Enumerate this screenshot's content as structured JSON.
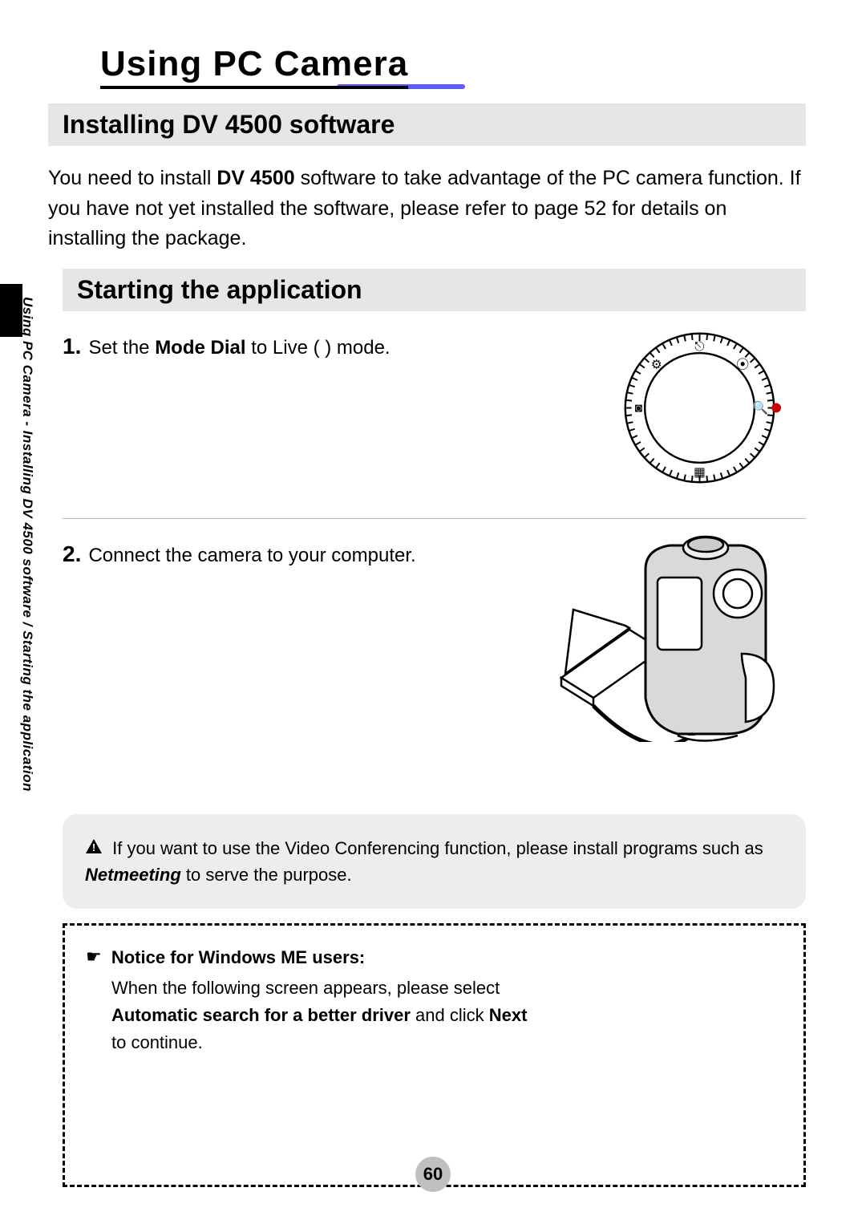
{
  "title": "Using PC Camera",
  "section1": {
    "heading": "Installing DV 4500 software",
    "para_pre": "You need to install ",
    "para_bold": "DV 4500",
    "para_post": " software to take advantage of the PC camera function. If you have not yet installed the software, please refer to page 52 for details on installing the package."
  },
  "section2": {
    "heading": "Starting the application",
    "step1": {
      "num": "1.",
      "pre": " Set the ",
      "bold": "Mode Dial",
      "post": " to Live (       ) mode."
    },
    "step2": {
      "num": "2.",
      "text": " Connect the camera to your computer."
    }
  },
  "infobox": {
    "pre": " If you want to use the Video Conferencing function, please install programs such as ",
    "bold": "Netmeeting",
    "post": " to serve the purpose."
  },
  "notice": {
    "heading": "Notice for Windows ME users:",
    "line1": "When the following screen appears, please select",
    "bold1": "Automatic search for a better driver",
    "mid": " and click ",
    "bold2": "Next",
    "line2": "to continue."
  },
  "breadcrumb": "Using PC Camera - Installing DV 4500 software / Starting the application",
  "page_number": "60"
}
